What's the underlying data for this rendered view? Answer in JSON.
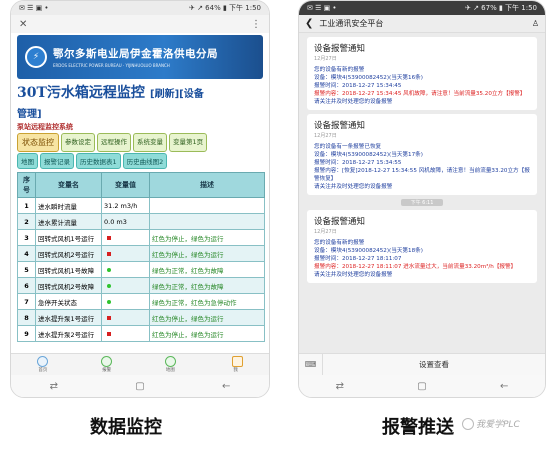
{
  "left_phone": {
    "status": {
      "left": "✉ ☰ ▣ •",
      "right": "✈ ↗ 64% ▮ 下午 1:50"
    },
    "app": {
      "close": "✕",
      "more": "⋮"
    },
    "banner": {
      "org_cn": "鄂尔多斯电业局伊金霍洛供电分局",
      "org_en": "ERDOS ELECTRIC POWER BUREAU · YIJINHUOLUO BRANCH"
    },
    "title": {
      "main": "30T污水箱远程监控",
      "refresh": "[刷新]",
      "manage_open": "[设备",
      "manage_close": "管理]"
    },
    "subtitle": "泵站远程监控系统",
    "tabs_row1": [
      "状态监控",
      "参数设定",
      "远程操作",
      "系统变量",
      "变量第1页"
    ],
    "tabs_row2": [
      "地图",
      "报警记录",
      "历史数据表1",
      "历史曲线图2"
    ],
    "table": {
      "headers": [
        "序号",
        "变量名",
        "变量值",
        "描述"
      ],
      "rows": [
        {
          "num": "1",
          "name": "进水瞬时流量",
          "value": "31.2 m3/h",
          "desc": "",
          "indicator": "none"
        },
        {
          "num": "2",
          "name": "进水累计流量",
          "value": "0.0 m3",
          "desc": "",
          "indicator": "none"
        },
        {
          "num": "3",
          "name": "回转式风机1号运行",
          "value": "",
          "desc": "红色为停止，绿色为运行",
          "indicator": "red"
        },
        {
          "num": "4",
          "name": "回转式风机2号运行",
          "value": "",
          "desc": "红色为停止，绿色为运行",
          "indicator": "red"
        },
        {
          "num": "5",
          "name": "回转式风机1号故障",
          "value": "",
          "desc": "绿色为正常，红色为故障",
          "indicator": "green"
        },
        {
          "num": "6",
          "name": "回转式风机2号故障",
          "value": "",
          "desc": "绿色为正常，红色为故障",
          "indicator": "green"
        },
        {
          "num": "7",
          "name": "急停开关状态",
          "value": "",
          "desc": "绿色为正常，红色为急停动作",
          "indicator": "green"
        },
        {
          "num": "8",
          "name": "进水提升泵1号运行",
          "value": "",
          "desc": "红色为停止，绿色为运行",
          "indicator": "red"
        },
        {
          "num": "9",
          "name": "进水提升泵2号运行",
          "value": "",
          "desc": "红色为停止，绿色为运行",
          "indicator": "red"
        }
      ]
    },
    "bottom_nav": [
      "首页",
      "报警",
      "地图",
      "我"
    ],
    "nav": [
      "⇄",
      "▢",
      "←"
    ]
  },
  "right_phone": {
    "status": {
      "left": "✉ ☰ ▣ •",
      "right": "✈ ↗ 67% ▮ 下午 1:50"
    },
    "header": {
      "back": "❮",
      "title": "工业通讯安全平台",
      "user_icon": "♙"
    },
    "cards": [
      {
        "title": "设备报警通知",
        "date": "12月27日",
        "lines": [
          {
            "text": "您的设备有新的报警",
            "red": false
          },
          {
            "text": "设备：模块4(53900082452)(当天第16条)",
            "red": false
          },
          {
            "text": "报警时间：2018-12-27 15:34:45",
            "red": false
          },
          {
            "text": "报警内容：2018-12-27 15:34:45 风机故障，请注意！当前流量35.20立方【报警】",
            "red": true
          },
          {
            "text": "请关注并及时处理您的设备报警",
            "red": false
          }
        ]
      },
      {
        "title": "设备报警通知",
        "date": "12月27日",
        "lines": [
          {
            "text": "您的设备有一条报警已恢复",
            "red": false
          },
          {
            "text": "设备：模块4(53900082452)(当天第17条)",
            "red": false
          },
          {
            "text": "报警时间：2018-12-27 15:34:55",
            "red": false
          },
          {
            "text": "报警内容：[恢复]2018-12-27 15:34:55 风机故障，请注意！当前流量33.20立方【报警恢复】",
            "red": false
          },
          {
            "text": "请关注并及时处理您的设备报警",
            "red": false
          }
        ]
      },
      {
        "title": "设备报警通知",
        "date": "12月27日",
        "lines": [
          {
            "text": "您的设备有新的报警",
            "red": false
          },
          {
            "text": "设备：模块4(53900082452)(当天第18条)",
            "red": false
          },
          {
            "text": "报警时间：2018-12-27 18:11:07",
            "red": false
          },
          {
            "text": "报警内容：2018-12-27 18:11:07 进水流量过大，当前流量33.20m³/h【报警】",
            "red": true
          },
          {
            "text": "请关注并及时处理您的设备报警",
            "red": false
          }
        ]
      }
    ],
    "timestamp": "下午 6:11",
    "menu": {
      "keyboard": "⌨",
      "label": "设置查看"
    },
    "nav": [
      "⇄",
      "▢",
      "←"
    ]
  },
  "captions": {
    "left": "数据监控",
    "right": "报警推送"
  },
  "watermark": "我爱学PLC"
}
